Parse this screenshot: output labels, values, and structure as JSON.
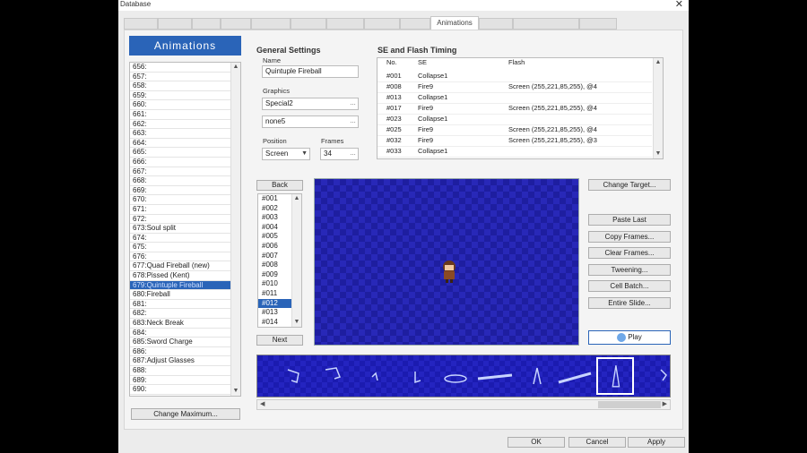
{
  "window": {
    "title": "Database",
    "close_glyph": "✕"
  },
  "tabs": [
    {
      "label": ""
    },
    {
      "label": ""
    },
    {
      "label": ""
    },
    {
      "label": ""
    },
    {
      "label": ""
    },
    {
      "label": ""
    },
    {
      "label": ""
    },
    {
      "label": ""
    },
    {
      "label": "Animations"
    },
    {
      "label": ""
    },
    {
      "label": ""
    },
    {
      "label": ""
    },
    {
      "label": ""
    }
  ],
  "animations": {
    "header": "Animations",
    "items": [
      "656:",
      "657:",
      "658:",
      "659:",
      "660:",
      "661:",
      "662:",
      "663:",
      "664:",
      "665:",
      "666:",
      "667:",
      "668:",
      "669:",
      "670:",
      "671:",
      "672:",
      "673:Soul split",
      "674:",
      "675:",
      "676:",
      "677:Quad Fireball (new)",
      "678:Pissed (Kent)",
      "679:Quintuple Fireball",
      "680:Fireball",
      "681:",
      "682:",
      "683:Neck Break",
      "684:",
      "685:Sword Charge",
      "686:",
      "687:Adjust Glasses",
      "688:",
      "689:",
      "690:"
    ],
    "selected_index": 23,
    "change_max_label": "Change Maximum..."
  },
  "general": {
    "title": "General Settings",
    "name_label": "Name",
    "name_value": "Quintuple Fireball",
    "graphics_label": "Graphics",
    "graphic1": "Special2",
    "graphic2": "none5",
    "position_label": "Position",
    "position_value": "Screen",
    "frames_label": "Frames",
    "frames_value": "34"
  },
  "se_timing": {
    "title": "SE and Flash Timing",
    "headers": {
      "no": "No.",
      "se": "SE",
      "flash": "Flash"
    },
    "rows": [
      {
        "no": "#001",
        "se": "Collapse1",
        "flash": ""
      },
      {
        "no": "#008",
        "se": "Fire9",
        "flash": "Screen (255,221,85,255), @4"
      },
      {
        "no": "#013",
        "se": "Collapse1",
        "flash": ""
      },
      {
        "no": "#017",
        "se": "Fire9",
        "flash": "Screen (255,221,85,255), @4"
      },
      {
        "no": "#023",
        "se": "Collapse1",
        "flash": ""
      },
      {
        "no": "#025",
        "se": "Fire9",
        "flash": "Screen (255,221,85,255), @4"
      },
      {
        "no": "#032",
        "se": "Fire9",
        "flash": "Screen (255,221,85,255), @3"
      },
      {
        "no": "#033",
        "se": "Collapse1",
        "flash": ""
      }
    ]
  },
  "frames": {
    "back_label": "Back",
    "next_label": "Next",
    "items": [
      "#001",
      "#002",
      "#003",
      "#004",
      "#005",
      "#006",
      "#007",
      "#008",
      "#009",
      "#010",
      "#011",
      "#012",
      "#013",
      "#014"
    ],
    "selected_index": 11
  },
  "controls": {
    "change_target": "Change Target...",
    "paste_last": "Paste Last",
    "copy_frames": "Copy Frames...",
    "clear_frames": "Clear Frames...",
    "tweening": "Tweening...",
    "cell_batch": "Cell Batch...",
    "entire_slide": "Entire Slide...",
    "play": "Play"
  },
  "footer": {
    "ok": "OK",
    "cancel": "Cancel",
    "apply": "Apply"
  },
  "colors": {
    "accent": "#2a64b8",
    "canvas_bg": "#1e1ea0"
  }
}
